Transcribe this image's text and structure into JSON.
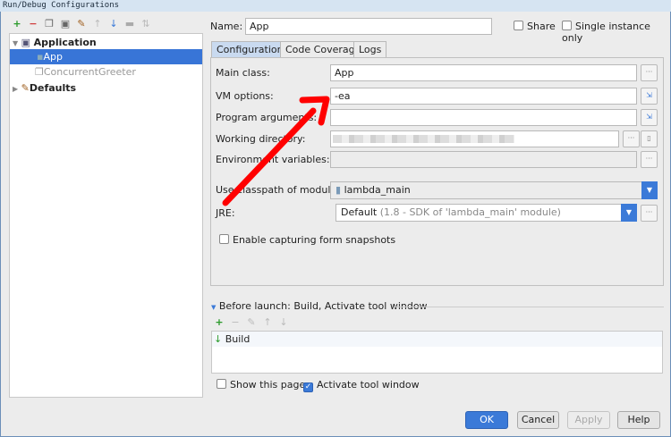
{
  "window": {
    "title": "Run/Debug Configurations"
  },
  "toolbar": {
    "icons": [
      "plus-icon",
      "minus-icon",
      "copy-icon",
      "save-icon",
      "wrench-icon",
      "arrow-up-icon",
      "arrow-down-icon",
      "folder-icon",
      "sort-icon"
    ]
  },
  "tree": {
    "application": "Application",
    "app": "App",
    "greeter": "ConcurrentGreeter",
    "defaults": "Defaults"
  },
  "name": {
    "label": "Name:",
    "value": "App"
  },
  "share": {
    "label": "Share",
    "checked": false
  },
  "single": {
    "label": "Single instance only",
    "checked": false
  },
  "tabs": [
    {
      "label": "Configuration",
      "active": true
    },
    {
      "label": "Code Coverage"
    },
    {
      "label": "Logs"
    }
  ],
  "form": {
    "main_class": {
      "label": "Main class:",
      "value": "App"
    },
    "vm": {
      "label": "VM options:",
      "value": "-ea"
    },
    "args": {
      "label": "Program arguments:",
      "value": ""
    },
    "wd": {
      "label": "Working directory:"
    },
    "env": {
      "label": "Environment variables:",
      "value": ""
    },
    "classpath": {
      "label": "Use classpath of module:",
      "value": "lambda_main"
    },
    "jre": {
      "label": "JRE:",
      "value": "Default",
      "hint": "(1.8 - SDK of 'lambda_main' module)"
    },
    "snapshots": {
      "label": "Enable capturing form snapshots",
      "checked": false
    }
  },
  "before": {
    "title": "Before launch: Build, Activate tool window",
    "items": [
      "Build"
    ]
  },
  "show_page": {
    "label": "Show this page",
    "checked": false
  },
  "activate": {
    "label": "Activate tool window",
    "checked": true
  },
  "buttons": {
    "ok": "OK",
    "cancel": "Cancel",
    "apply": "Apply",
    "help": "Help"
  },
  "colors": {
    "accent": "#3875d7",
    "arrow": "#ff0000"
  }
}
